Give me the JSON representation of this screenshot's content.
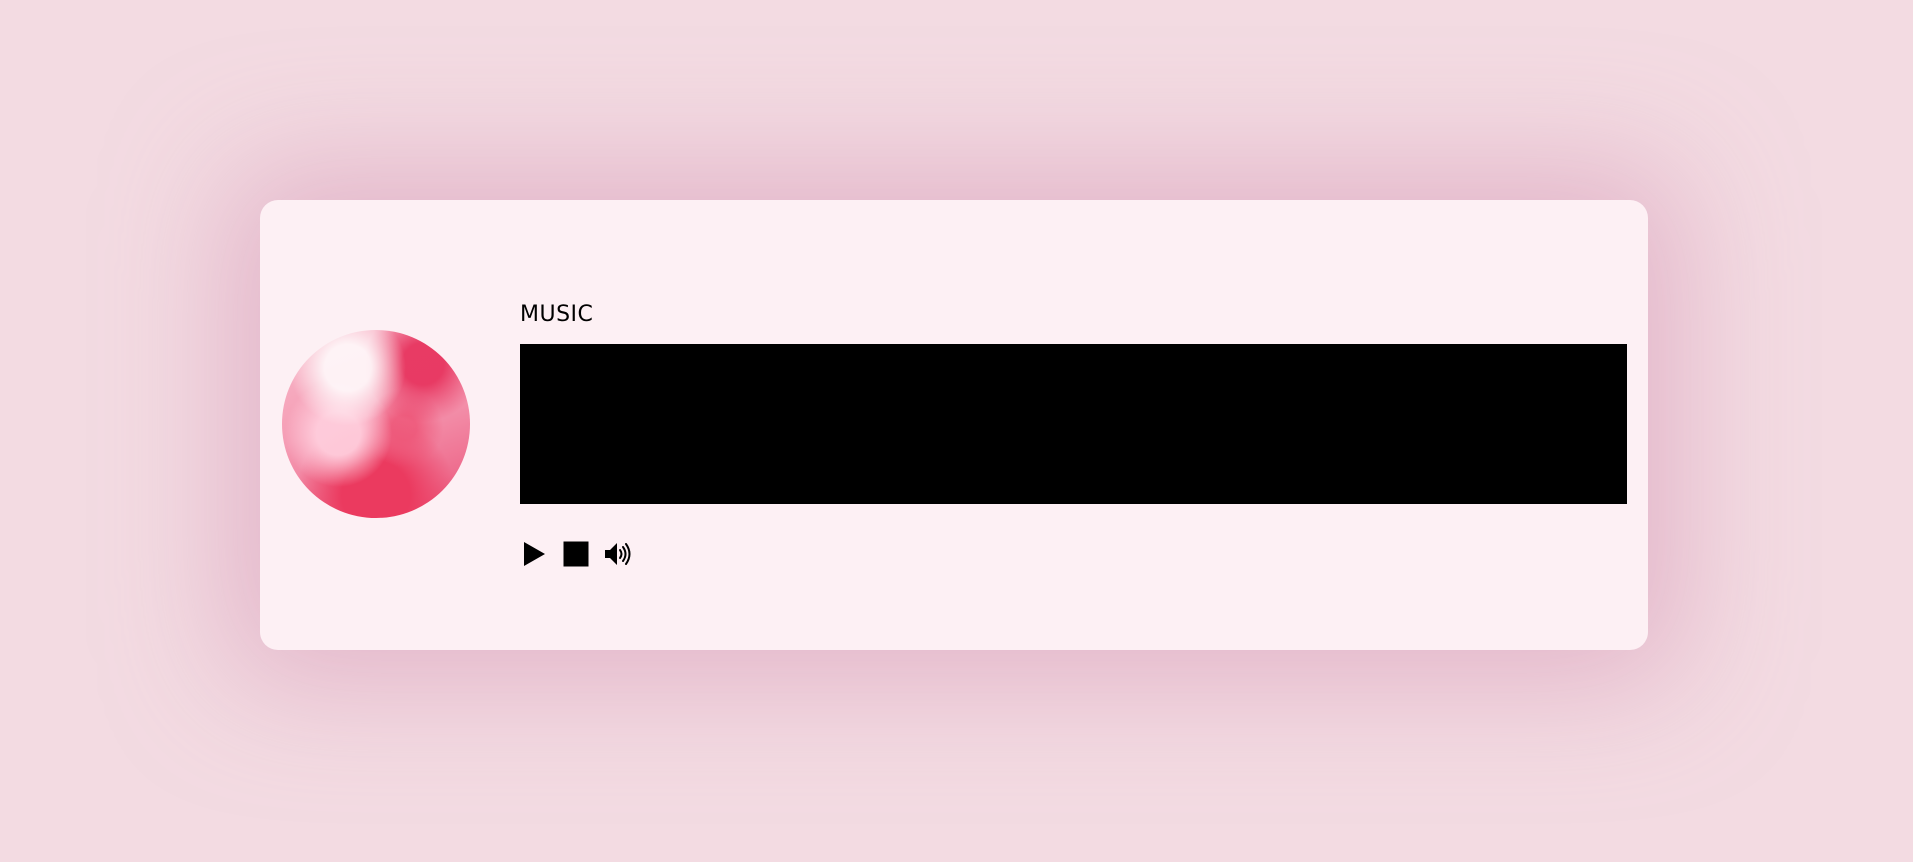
{
  "player": {
    "title": "MUSIC"
  },
  "cover": {
    "icon": "cover-art-image"
  },
  "controls": {
    "play_icon": "play-icon",
    "stop_icon": "stop-icon",
    "volume_icon": "volume-icon"
  },
  "colors": {
    "page_background": "#f3dbe2",
    "card_background": "#fdf0f4",
    "video_background": "#000000",
    "accent_pink": "#e9436b"
  }
}
